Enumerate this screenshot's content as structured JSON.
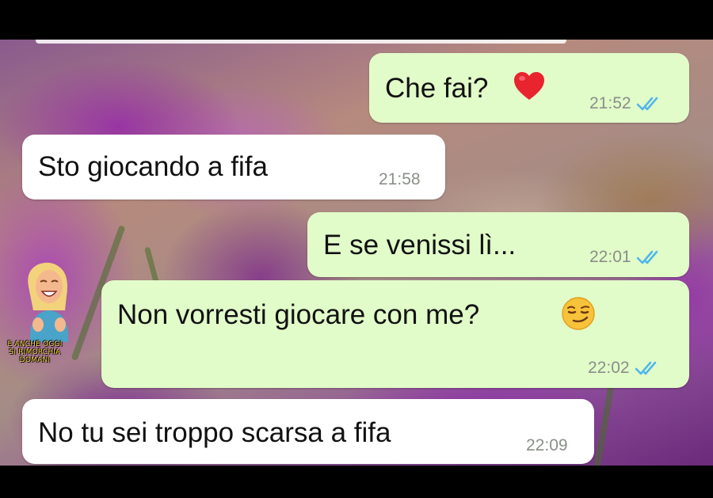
{
  "messages": [
    {
      "direction": "outgoing",
      "text": "Che fai?",
      "emoji": "red-heart",
      "time": "21:52",
      "status": "read"
    },
    {
      "direction": "incoming",
      "text": "Sto giocando a fifa",
      "time": "21:58"
    },
    {
      "direction": "outgoing",
      "text": "E se venissi lì...",
      "time": "22:01",
      "status": "read"
    },
    {
      "direction": "outgoing",
      "text": "Non vorresti giocare con me?",
      "emoji": "smirking-face",
      "time": "22:02",
      "status": "read"
    },
    {
      "direction": "incoming",
      "text": "No tu sei troppo scarsa a fifa",
      "time": "22:09"
    }
  ],
  "watermark": {
    "line1": "E ANCHE OGGI",
    "line2": "SI RIMORCHIA DOMANI"
  },
  "colors": {
    "outgoing_bubble": "#e1fbc9",
    "incoming_bubble": "#ffffff",
    "read_ticks": "#4fb6ec",
    "time_text": "#8a8f88"
  }
}
